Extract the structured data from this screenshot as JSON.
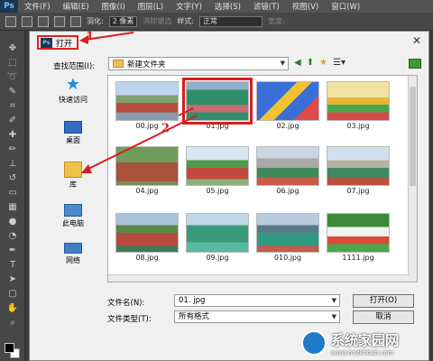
{
  "app": {
    "logo": "Ps"
  },
  "menu": [
    "文件(F)",
    "编辑(E)",
    "图像(I)",
    "图层(L)",
    "文字(Y)",
    "选择(S)",
    "滤镜(T)",
    "视图(V)",
    "窗口(W)"
  ],
  "options": {
    "feather_label": "羽化:",
    "feather_value": "2 像素",
    "antialias": "消除锯齿",
    "style_label": "样式:",
    "style_value": "正常",
    "width_label": "宽度:"
  },
  "dialog": {
    "title": "打开",
    "look_in_label": "查找范围(I):",
    "look_in_value": "新建文件夹",
    "places": [
      "快速访问",
      "桌面",
      "库",
      "此电脑",
      "网络"
    ],
    "files": [
      "00.jpg",
      "01.jpg",
      "02.jpg",
      "03.jpg",
      "04.jpg",
      "05.jpg",
      "06.jpg",
      "07.jpg",
      "08.jpg",
      "09.jpg",
      "010.jpg",
      "1111.jpg"
    ],
    "selected_file": "01.jpg",
    "filename_label": "文件名(N):",
    "filename_value": "01. jpg",
    "filetype_label": "文件类型(T):",
    "filetype_value": "所有格式",
    "open_button": "打开(O)",
    "cancel_button": "取消",
    "marker_1": "1",
    "marker_2": "2"
  },
  "watermark": {
    "text": "系统家园网",
    "url": "www.hnzkhbsb.com"
  },
  "colors": {
    "accent_red": "#d81e1e",
    "ps_blue": "#1e3652"
  }
}
